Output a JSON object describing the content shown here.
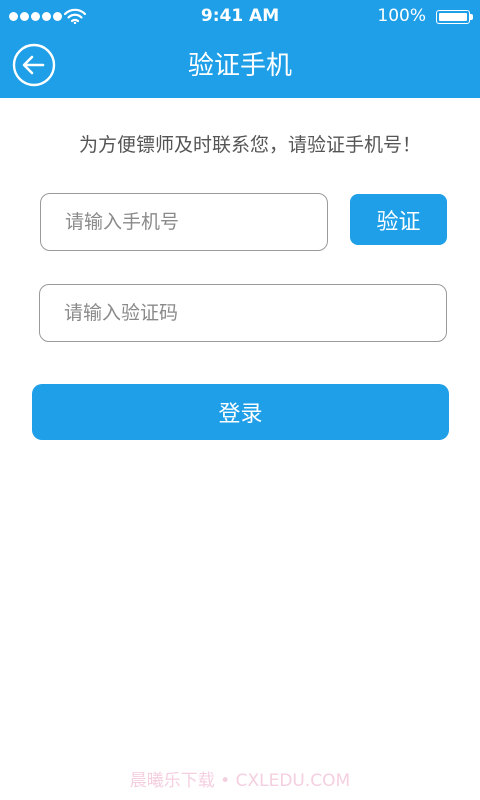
{
  "status_bar": {
    "time": "9:41 AM",
    "battery": "100%"
  },
  "header": {
    "title": "验证手机"
  },
  "main": {
    "notice": "为方便镖师及时联系您，请验证手机号！",
    "phone_placeholder": "请输入手机号",
    "verify_label": "验证",
    "code_placeholder": "请输入验证码",
    "login_label": "登录"
  },
  "footer": {
    "watermark": "晨曦乐下载 • CXLEDU.COM"
  },
  "colors": {
    "primary": "#1e9fe8",
    "text_gray": "#555555",
    "border_gray": "#9a9a9a"
  },
  "icons": {
    "back": "back-arrow-icon",
    "wifi": "wifi-icon",
    "battery": "battery-icon",
    "signal": "signal-dots-icon"
  }
}
